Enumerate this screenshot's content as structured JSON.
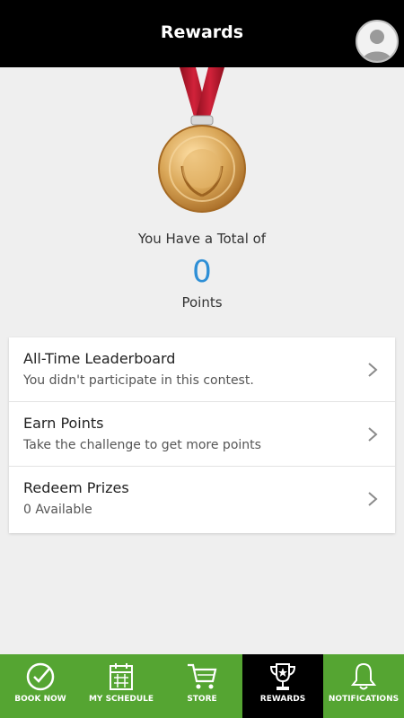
{
  "header": {
    "title": "Rewards"
  },
  "summary": {
    "total_label": "You Have a Total of",
    "points_value": "0",
    "points_label": "Points"
  },
  "menu": [
    {
      "title": "All-Time Leaderboard",
      "subtitle": "You didn't participate in this contest."
    },
    {
      "title": "Earn Points",
      "subtitle": "Take the challenge to get more points"
    },
    {
      "title": "Redeem Prizes",
      "subtitle": "0 Available"
    }
  ],
  "tabs": [
    {
      "label": "BOOK NOW",
      "icon": "check-circle-icon"
    },
    {
      "label": "MY SCHEDULE",
      "icon": "calendar-icon"
    },
    {
      "label": "STORE",
      "icon": "cart-icon"
    },
    {
      "label": "REWARDS",
      "icon": "trophy-icon",
      "active": true
    },
    {
      "label": "NOTIFICATIONS",
      "icon": "bell-icon"
    }
  ],
  "colors": {
    "header_bg": "#000000",
    "tabbar_bg": "#55a532",
    "points_color": "#2e8fd6",
    "ribbon": "#c8102e",
    "medal_gold": "#d9a657"
  }
}
